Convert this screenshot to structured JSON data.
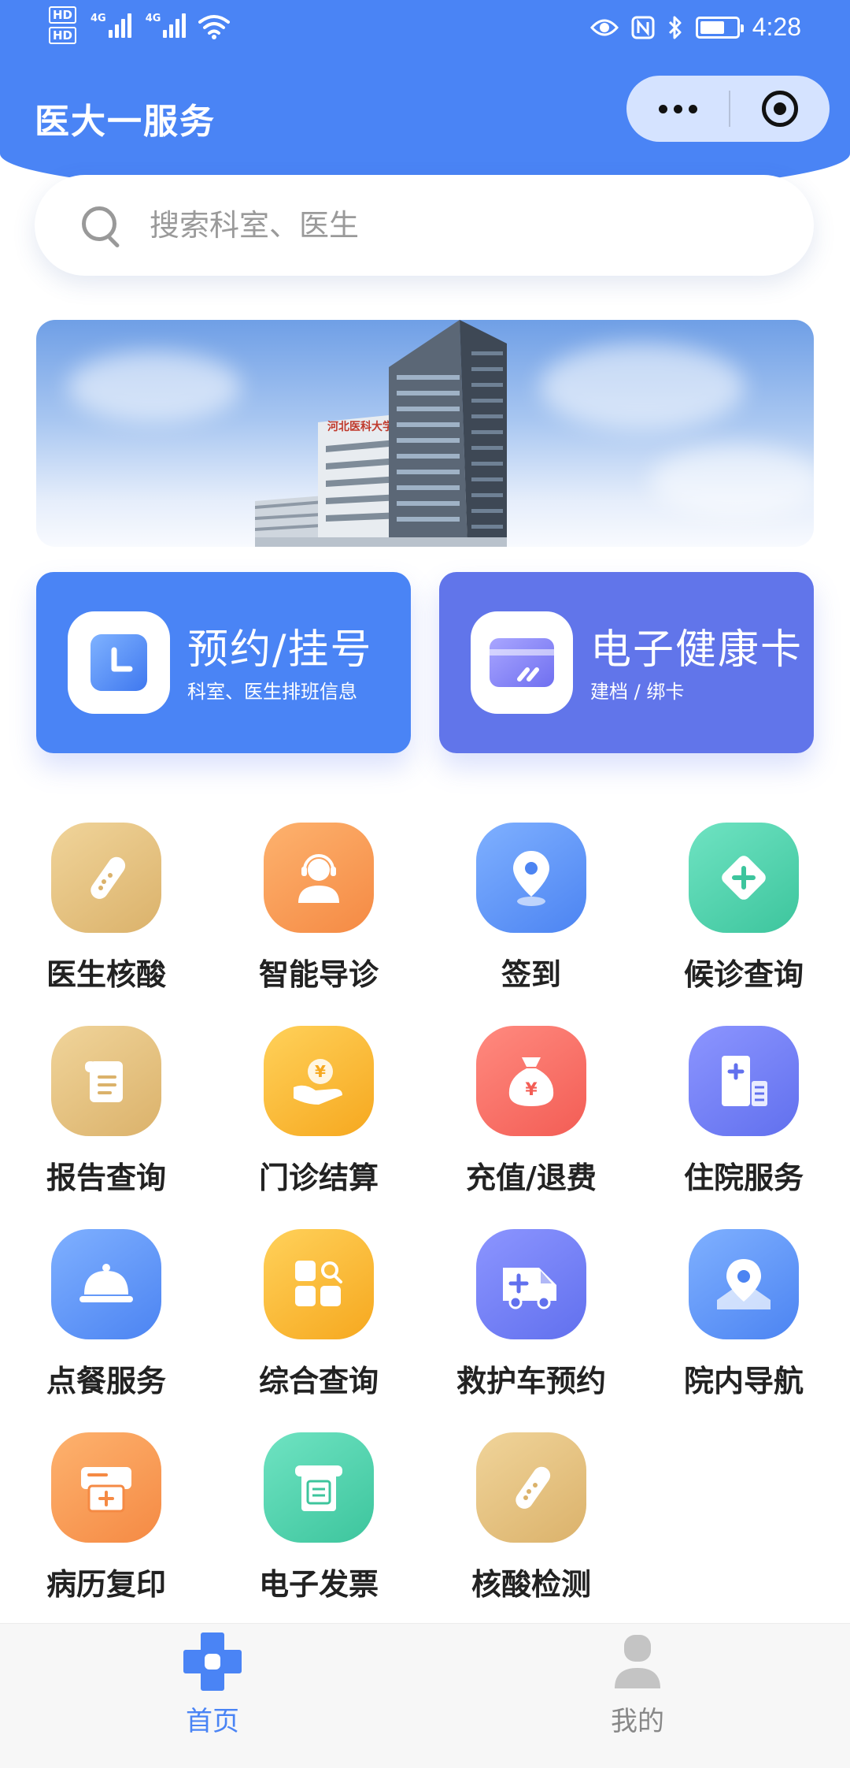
{
  "status_bar": {
    "hd1": "HD",
    "hd2": "HD",
    "net1": "4G",
    "net2": "4G",
    "time": "4:28"
  },
  "header": {
    "title": "医大一服务"
  },
  "search": {
    "placeholder": "搜索科室、医生"
  },
  "banner": {
    "sign_text": "河北医科大学第一医院"
  },
  "cards": [
    {
      "title": "预约/挂号",
      "subtitle": "科室、医生排班信息",
      "icon": "clock-icon",
      "color": "#4a84f5"
    },
    {
      "title": "电子健康卡",
      "subtitle": "建档 / 绑卡",
      "icon": "card-icon",
      "color": "#6175ea"
    }
  ],
  "grid": [
    {
      "label": "医生核酸",
      "icon": "test-tube-icon"
    },
    {
      "label": "智能导诊",
      "icon": "headset-agent-icon"
    },
    {
      "label": "签到",
      "icon": "location-pin-icon"
    },
    {
      "label": "候诊查询",
      "icon": "diamond-plus-icon"
    },
    {
      "label": "报告查询",
      "icon": "report-scroll-icon"
    },
    {
      "label": "门诊结算",
      "icon": "yen-coin-hand-icon"
    },
    {
      "label": "充值/退费",
      "icon": "money-bag-icon"
    },
    {
      "label": "住院服务",
      "icon": "hospital-building-icon"
    },
    {
      "label": "点餐服务",
      "icon": "food-cloche-icon"
    },
    {
      "label": "综合查询",
      "icon": "grid-search-icon"
    },
    {
      "label": "救护车预约",
      "icon": "ambulance-icon"
    },
    {
      "label": "院内导航",
      "icon": "map-pin-icon"
    },
    {
      "label": "病历复印",
      "icon": "printer-icon"
    },
    {
      "label": "电子发票",
      "icon": "invoice-icon"
    },
    {
      "label": "核酸检测",
      "icon": "test-tube-icon"
    }
  ],
  "tabbar": {
    "home": "首页",
    "mine": "我的"
  },
  "colors": {
    "primary": "#4a84f5",
    "secondary": "#6175ea"
  }
}
